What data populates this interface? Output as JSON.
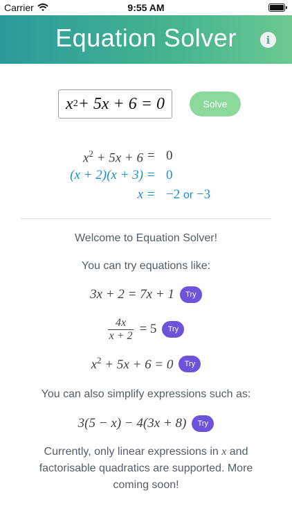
{
  "status_bar": {
    "carrier": "Carrier",
    "time": "9:55 AM"
  },
  "header": {
    "title": "Equation Solver"
  },
  "input": {
    "value_base": "x",
    "value_exp": "2",
    "value_rest": " + 5x + 6 = 0"
  },
  "solve_button": {
    "label": "Solve"
  },
  "steps": [
    {
      "lhs_base": "x",
      "lhs_exp": "2",
      "lhs_rest": " + 5x + 6",
      "eq": "=",
      "rhs": "0"
    },
    {
      "lhs": "(x + 2)(x + 3)",
      "eq": "=",
      "rhs": "0"
    },
    {
      "lhs": "x",
      "eq": "=",
      "rhs_a": "−2",
      "or": "or",
      "rhs_b": "−3"
    }
  ],
  "welcome": {
    "heading": "Welcome to Equation Solver!",
    "try_intro": "You can try equations like:"
  },
  "examples": [
    {
      "text": "3x + 2 = 7x + 1",
      "button": "Try"
    },
    {
      "num": "4x",
      "den": "x + 2",
      "rest": " = 5",
      "button": "Try"
    },
    {
      "base": "x",
      "exp": "2",
      "rest": " + 5x + 6 = 0",
      "button": "Try"
    }
  ],
  "simplify": {
    "intro": "You can also simplify expressions such as:",
    "expression": "3(5 − x) − 4(3x + 8)",
    "button": "Try"
  },
  "footer": {
    "line1_a": "Currently, only linear expressions in ",
    "line1_var": "x",
    "line1_b": " and",
    "line2": "factorisable quadratics are supported. More",
    "line3": "coming soon!"
  },
  "colors": {
    "header_start": "#2b9a9c",
    "header_end": "#6cc890",
    "solve": "#8bd99a",
    "try": "#6c53d9",
    "step_blue": "#1a8fd0"
  },
  "icons": {
    "wifi": "wifi-icon",
    "battery": "battery-icon",
    "info": "info-icon"
  }
}
